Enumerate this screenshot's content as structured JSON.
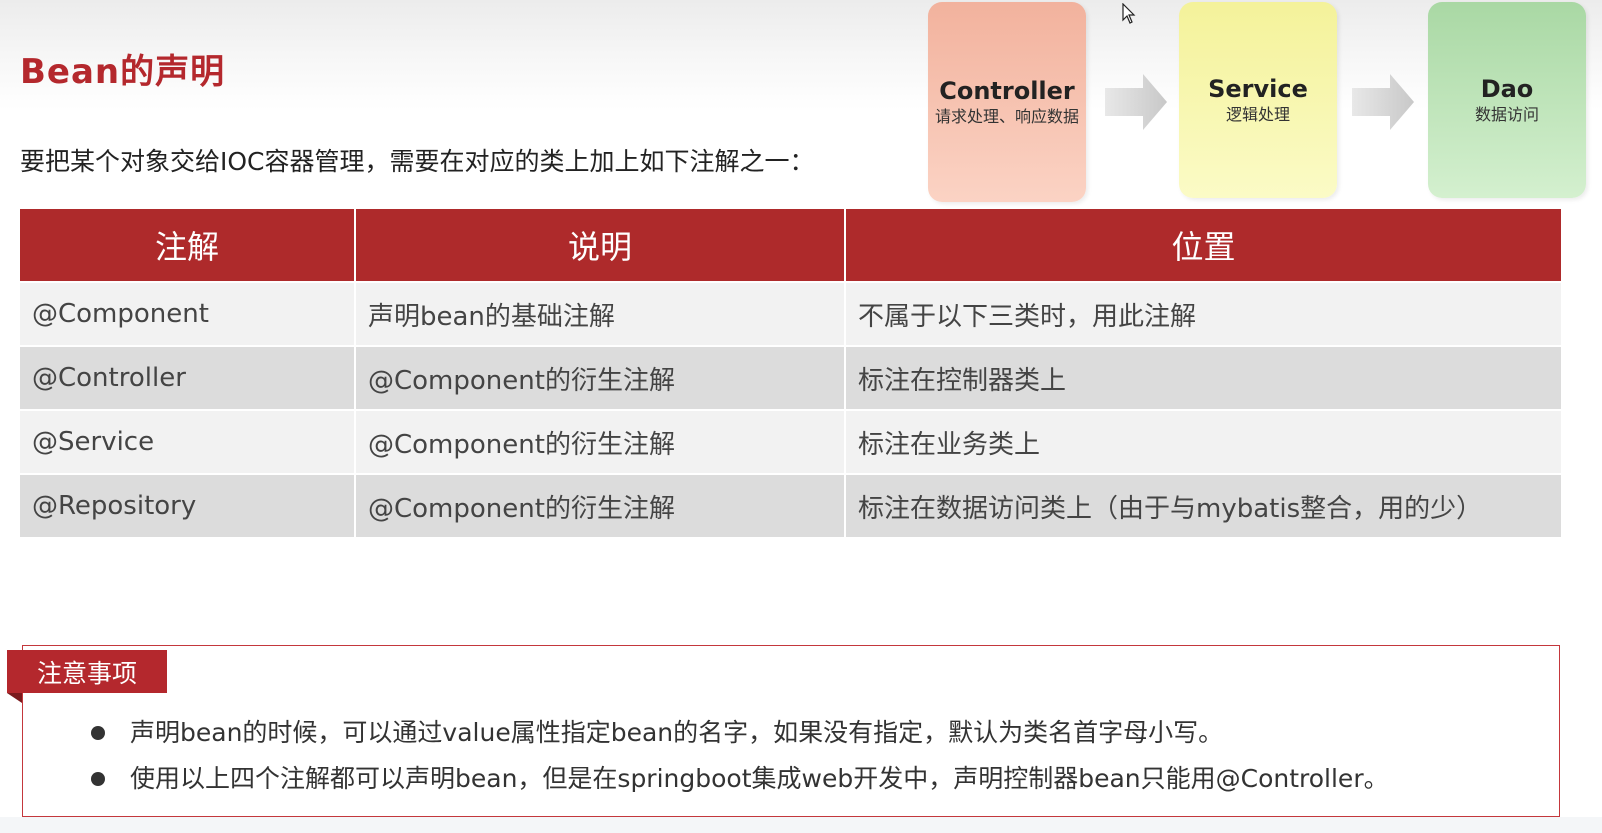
{
  "title": "Bean的声明",
  "intro": "要把某个对象交给IOC容器管理，需要在对应的类上加上如下注解之一：",
  "flow": [
    {
      "name": "Controller",
      "desc": "请求处理、响应数据"
    },
    {
      "name": "Service",
      "desc": "逻辑处理"
    },
    {
      "name": "Dao",
      "desc": "数据访问"
    }
  ],
  "table": {
    "headers": [
      "注解",
      "说明",
      "位置"
    ],
    "rows": [
      [
        "@Component",
        "声明bean的基础注解",
        "不属于以下三类时，用此注解"
      ],
      [
        "@Controller",
        "@Component的衍生注解",
        "标注在控制器类上"
      ],
      [
        "@Service",
        "@Component的衍生注解",
        "标注在业务类上"
      ],
      [
        "@Repository",
        "@Component的衍生注解",
        "标注在数据访问类上（由于与mybatis整合，用的少）"
      ]
    ]
  },
  "notes": {
    "title": "注意事项",
    "items": [
      "声明bean的时候，可以通过value属性指定bean的名字，如果没有指定，默认为类名首字母小写。",
      "使用以上四个注解都可以声明bean，但是在springboot集成web开发中，声明控制器bean只能用@Controller。"
    ]
  },
  "colors": {
    "accent": "#b4282d",
    "table_header": "#ae2a2b",
    "controller_box": "#f8c6b4",
    "service_box": "#f8f7b0",
    "dao_box": "#c2e6bc"
  }
}
